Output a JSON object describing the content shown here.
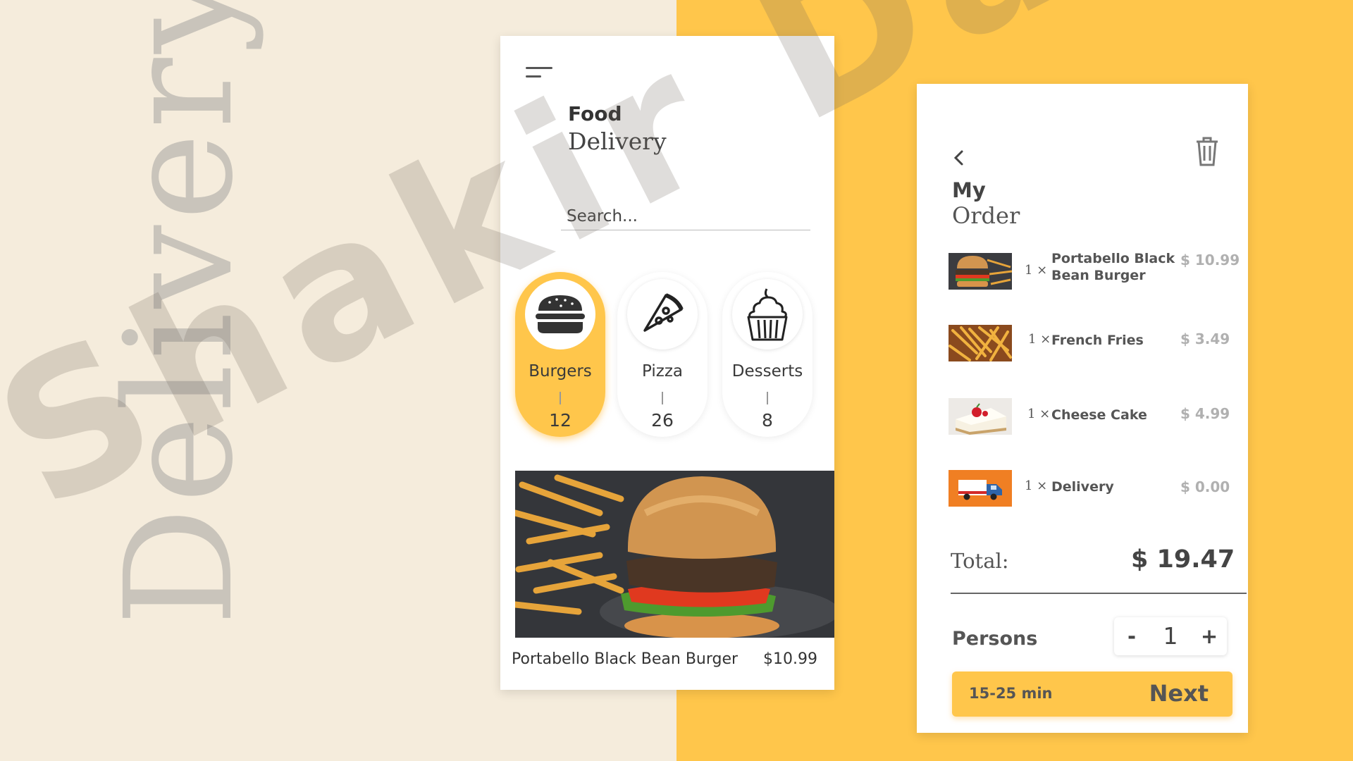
{
  "side_word": "Delivery",
  "watermark": "Shakir Davis",
  "colors": {
    "accent": "#FFC64B",
    "background_left": "#F5ECDC",
    "text": "#444444"
  },
  "home": {
    "title_bold": "Food",
    "title_serif": "Delivery",
    "search_placeholder": "Search...",
    "categories": [
      {
        "name": "Burgers",
        "count": "12",
        "icon": "burger-icon",
        "active": true
      },
      {
        "name": "Pizza",
        "count": "26",
        "icon": "pizza-icon",
        "active": false
      },
      {
        "name": "Desserts",
        "count": "8",
        "icon": "cupcake-icon",
        "active": false
      }
    ],
    "featured": {
      "name": "Portabello Black Bean Burger",
      "price": "$10.99"
    }
  },
  "order": {
    "title_bold": "My",
    "title_serif": "Order",
    "items": [
      {
        "qty": "1 ×",
        "name_line1": "Portabello Black",
        "name_line2": "Bean Burger",
        "price": "$ 10.99"
      },
      {
        "qty": "1 ×",
        "name_line1": "French Fries",
        "price": "$ 3.49"
      },
      {
        "qty": "1 ×",
        "name_line1": "Cheese Cake",
        "price": "$ 4.99"
      },
      {
        "qty": "1 ×",
        "name_line1": "Delivery",
        "price": "$ 0.00"
      }
    ],
    "total_label": "Total:",
    "total_value": "$ 19.47",
    "persons_label": "Persons",
    "persons_minus": "-",
    "persons_value": "1",
    "persons_plus": "+",
    "eta": "15-25 min",
    "next_label": "Next"
  }
}
